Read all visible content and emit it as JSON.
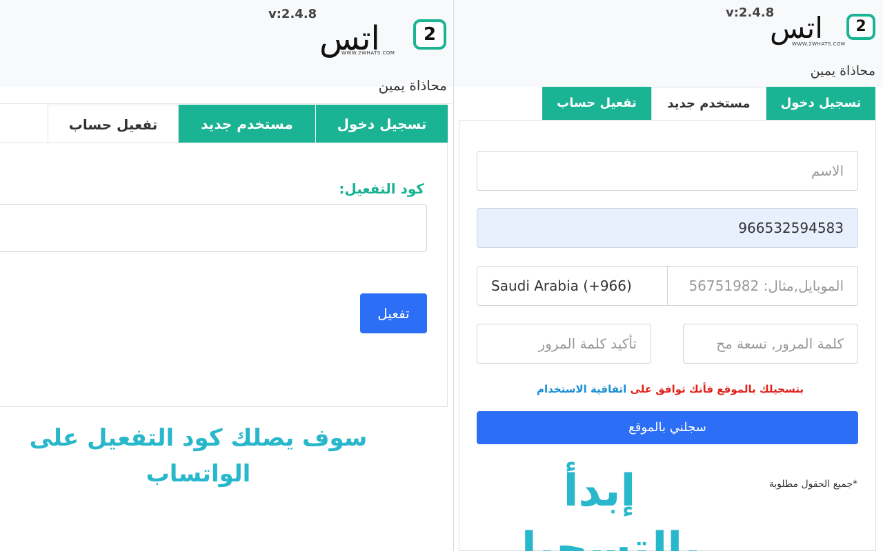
{
  "left": {
    "version": "v:2.4.8",
    "logo": {
      "wordmark": "اتس",
      "bubble": "2",
      "url": "WWW.2WHATS.COM"
    },
    "align_label": "محاذاة يمين",
    "tabs": [
      {
        "label": "تسجيل دخول",
        "active": false
      },
      {
        "label": "مستخدم جديد",
        "active": false
      },
      {
        "label": "تفعيل حساب",
        "active": true
      }
    ],
    "activation_label": "كود التفعيل:",
    "activation_value": "",
    "activate_button": "تفعيل",
    "caption": "سوف يصلك كود التفعيل على الواتساب"
  },
  "right": {
    "version": "v:2.4.8",
    "logo": {
      "wordmark": "اتس",
      "bubble": "2",
      "url": "WWW.2WHATS.COM"
    },
    "align_label": "محاذاة يمين",
    "tabs": [
      {
        "label": "تسجيل دخول",
        "active": false
      },
      {
        "label": "مستخدم جديد",
        "active": true
      },
      {
        "label": "تفعيل حساب",
        "active": false
      }
    ],
    "name_placeholder": "الاسم",
    "phone_value": "966532594583",
    "mobile_placeholder": "الموبايل,مثال: 56751982",
    "country_value": "Saudi Arabia (+966)",
    "password_placeholder": "كلمة المرور, تسعة مح",
    "confirm_placeholder": "تأكيد كلمة المرور",
    "terms_prefix": "بتسجيلك بالموقع فأنك توافق على",
    "terms_link": "اتفاقية الاستخدام",
    "register_button": "سجلني بالموقع",
    "required_note": "*جميع الحقول مطلوبة",
    "caption": "إبدأ بالتسجيل"
  },
  "colors": {
    "tab_green": "#1ab394",
    "button_blue": "#2d6ef6",
    "caption_cyan": "#28b7cb",
    "terms_red": "#e2231a",
    "terms_blue": "#1a8fd6"
  }
}
